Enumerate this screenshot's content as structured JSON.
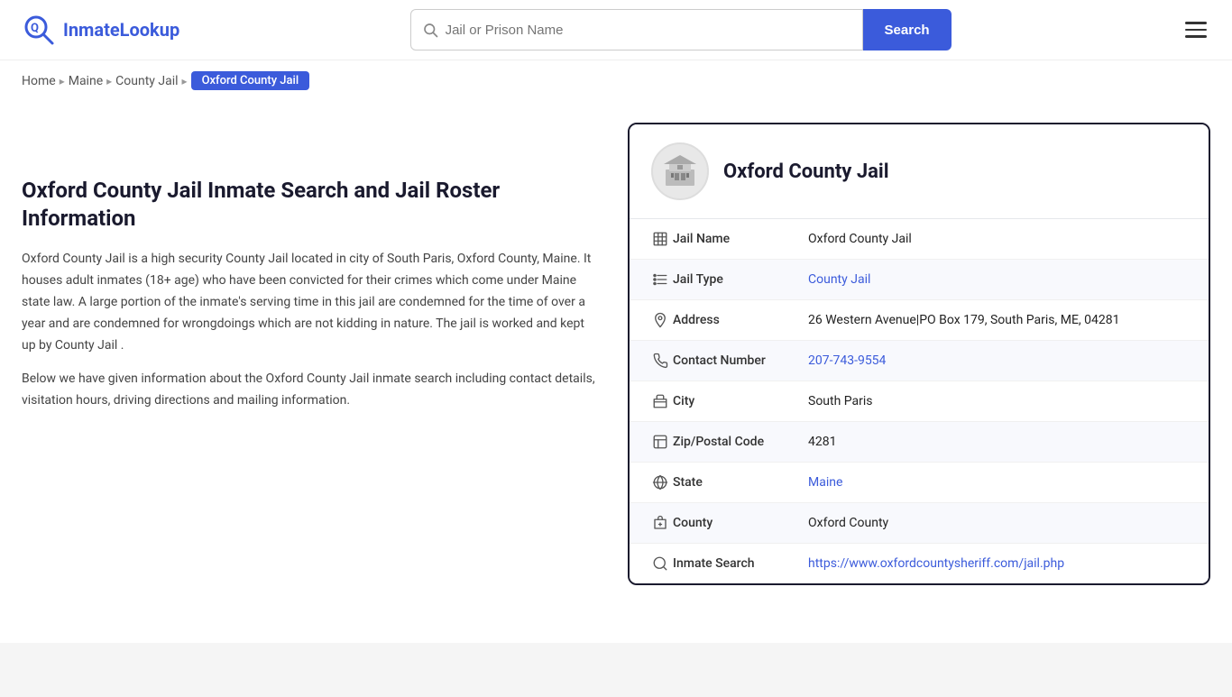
{
  "logo": {
    "brand": "InmateLookup",
    "brand_part1": "Inmate",
    "brand_part2": "Lookup"
  },
  "header": {
    "search_placeholder": "Jail or Prison Name",
    "search_button_label": "Search"
  },
  "breadcrumb": {
    "home": "Home",
    "state": "Maine",
    "type": "County Jail",
    "current": "Oxford County Jail"
  },
  "left": {
    "heading": "Oxford County Jail Inmate Search and Jail Roster Information",
    "description1": "Oxford County Jail is a high security County Jail located in city of South Paris, Oxford County, Maine. It houses adult inmates (18+ age) who have been convicted for their crimes which come under Maine state law. A large portion of the inmate's serving time in this jail are condemned for the time of over a year and are condemned for wrongdoings which are not kidding in nature. The jail is worked and kept up by County Jail .",
    "description2": "Below we have given information about the Oxford County Jail inmate search including contact details, visitation hours, driving directions and mailing information."
  },
  "card": {
    "title": "Oxford County Jail",
    "rows": [
      {
        "icon": "building-icon",
        "label": "Jail Name",
        "value": "Oxford County Jail",
        "link": null
      },
      {
        "icon": "list-icon",
        "label": "Jail Type",
        "value": "County Jail",
        "link": "#"
      },
      {
        "icon": "location-icon",
        "label": "Address",
        "value": "26 Western Avenue|PO Box 179, South Paris, ME, 04281",
        "link": null
      },
      {
        "icon": "phone-icon",
        "label": "Contact Number",
        "value": "207-743-9554",
        "link": "tel:207-743-9554"
      },
      {
        "icon": "city-icon",
        "label": "City",
        "value": "South Paris",
        "link": null
      },
      {
        "icon": "zip-icon",
        "label": "Zip/Postal Code",
        "value": "4281",
        "link": null
      },
      {
        "icon": "globe-icon",
        "label": "State",
        "value": "Maine",
        "link": "#"
      },
      {
        "icon": "county-icon",
        "label": "County",
        "value": "Oxford County",
        "link": null
      },
      {
        "icon": "search-globe-icon",
        "label": "Inmate Search",
        "value": "https://www.oxfordcountysheriff.com/jail.php",
        "link": "https://www.oxfordcountysheriff.com/jail.php"
      }
    ]
  }
}
